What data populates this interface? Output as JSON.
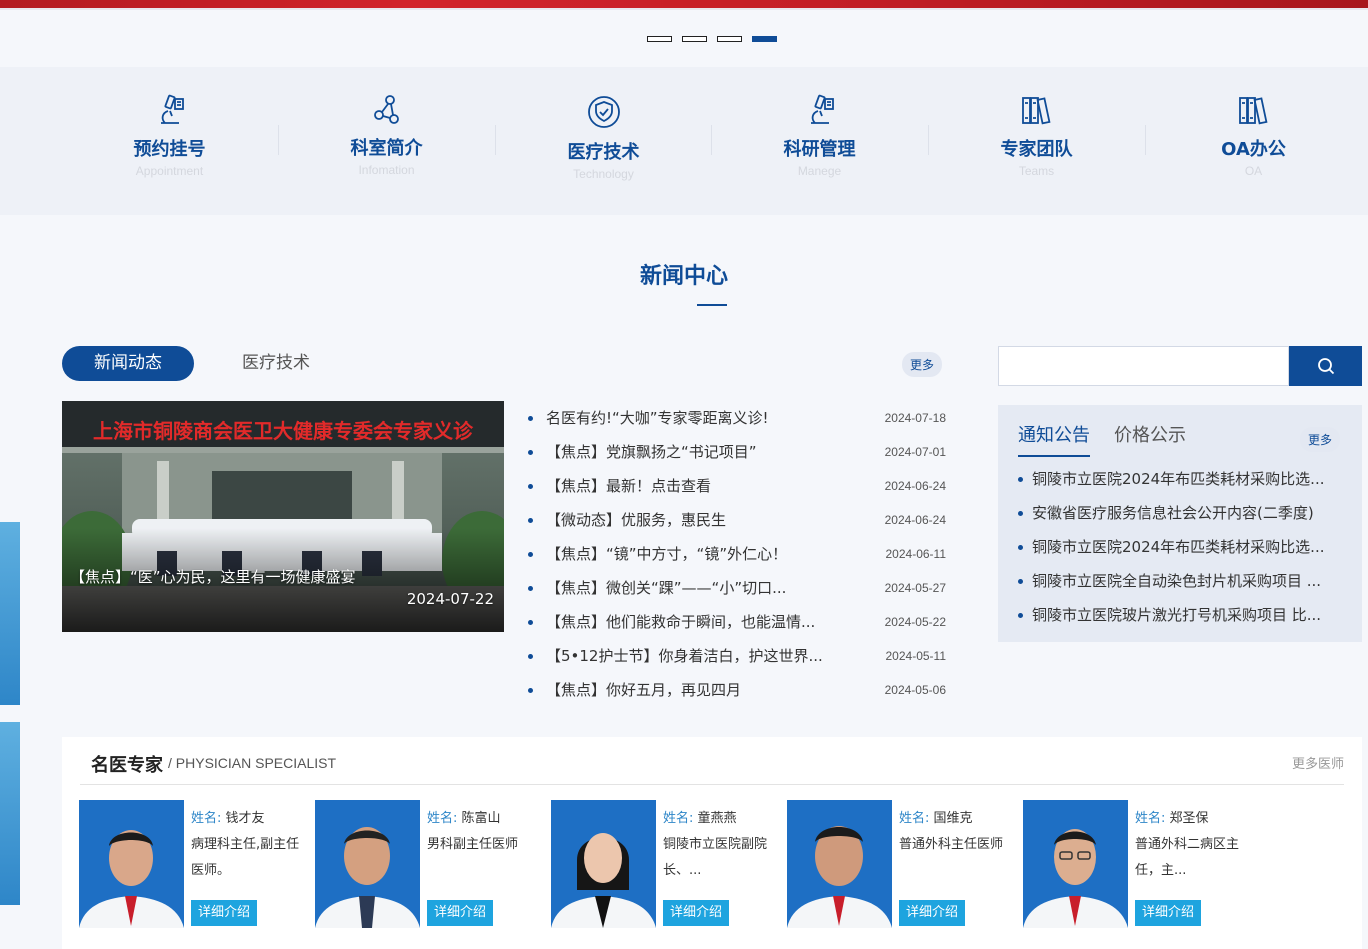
{
  "carousel": {
    "dots": 4,
    "active_index": 3
  },
  "quicknav": [
    {
      "title": "预约挂号",
      "sub": "Appointment",
      "icon": "microscope-icon"
    },
    {
      "title": "科室简介",
      "sub": "Infomation",
      "icon": "network-icon"
    },
    {
      "title": "医疗技术",
      "sub": "Technology",
      "icon": "shield-check-icon"
    },
    {
      "title": "科研管理",
      "sub": "Manege",
      "icon": "microscope-icon"
    },
    {
      "title": "专家团队",
      "sub": "Teams",
      "icon": "books-icon"
    },
    {
      "title": "OA办公",
      "sub": "OA",
      "icon": "books-icon"
    }
  ],
  "news_section": {
    "title": "新闻中心",
    "tabs": [
      "新闻动态",
      "医疗技术"
    ],
    "more": "更多",
    "feature": {
      "banner_text": "上海市铜陵商会医卫大健康专委会专家义诊",
      "title": "【焦点】“医”心为民，这里有一场健康盛宴",
      "date": "2024-07-22"
    },
    "items": [
      {
        "title": "名医有约!“大咖”专家零距离义诊!",
        "date": "2024-07-18"
      },
      {
        "title": "【焦点】党旗飘扬之“书记项目”",
        "date": "2024-07-01"
      },
      {
        "title": "【焦点】最新！点击查看",
        "date": "2024-06-24"
      },
      {
        "title": "【微动态】优服务，惠民生",
        "date": "2024-06-24"
      },
      {
        "title": "【焦点】“镜”中方寸，“镜”外仁心！",
        "date": "2024-06-11"
      },
      {
        "title": "【焦点】微创关“踝”——“小”切口...",
        "date": "2024-05-27"
      },
      {
        "title": "【焦点】他们能救命于瞬间，也能温情...",
        "date": "2024-05-22"
      },
      {
        "title": "【5•12护士节】你身着洁白，护这世界...",
        "date": "2024-05-11"
      },
      {
        "title": "【焦点】你好五月，再见四月",
        "date": "2024-05-06"
      }
    ]
  },
  "search": {
    "placeholder": ""
  },
  "notice": {
    "tabs": [
      "通知公告",
      "价格公示"
    ],
    "more": "更多",
    "items": [
      "铜陵市立医院2024年布匹类耗材采购比选...",
      "安徽省医疗服务信息社会公开内容(二季度)",
      "铜陵市立医院2024年布匹类耗材采购比选...",
      "铜陵市立医院全自动染色封片机采购项目 ...",
      "铜陵市立医院玻片激光打号机采购项目 比..."
    ]
  },
  "experts": {
    "title": "名医专家",
    "subtitle": "/ PHYSICIAN SPECIALIST",
    "more": "更多医师",
    "name_label": "姓名:",
    "button": "详细介绍",
    "doctors": [
      {
        "name": "钱才友",
        "desc": "病理科主任,副主任医师。"
      },
      {
        "name": "陈富山",
        "desc": "男科副主任医师"
      },
      {
        "name": "童燕燕",
        "desc": "铜陵市立医院副院长、..."
      },
      {
        "name": "国维克",
        "desc": "普通外科主任医师"
      },
      {
        "name": "郑圣保",
        "desc": "普通外科二病区主任，主..."
      }
    ]
  },
  "colors": {
    "primary": "#0f4c97",
    "accent": "#1ea4df",
    "banner_red": "#c41f27"
  }
}
